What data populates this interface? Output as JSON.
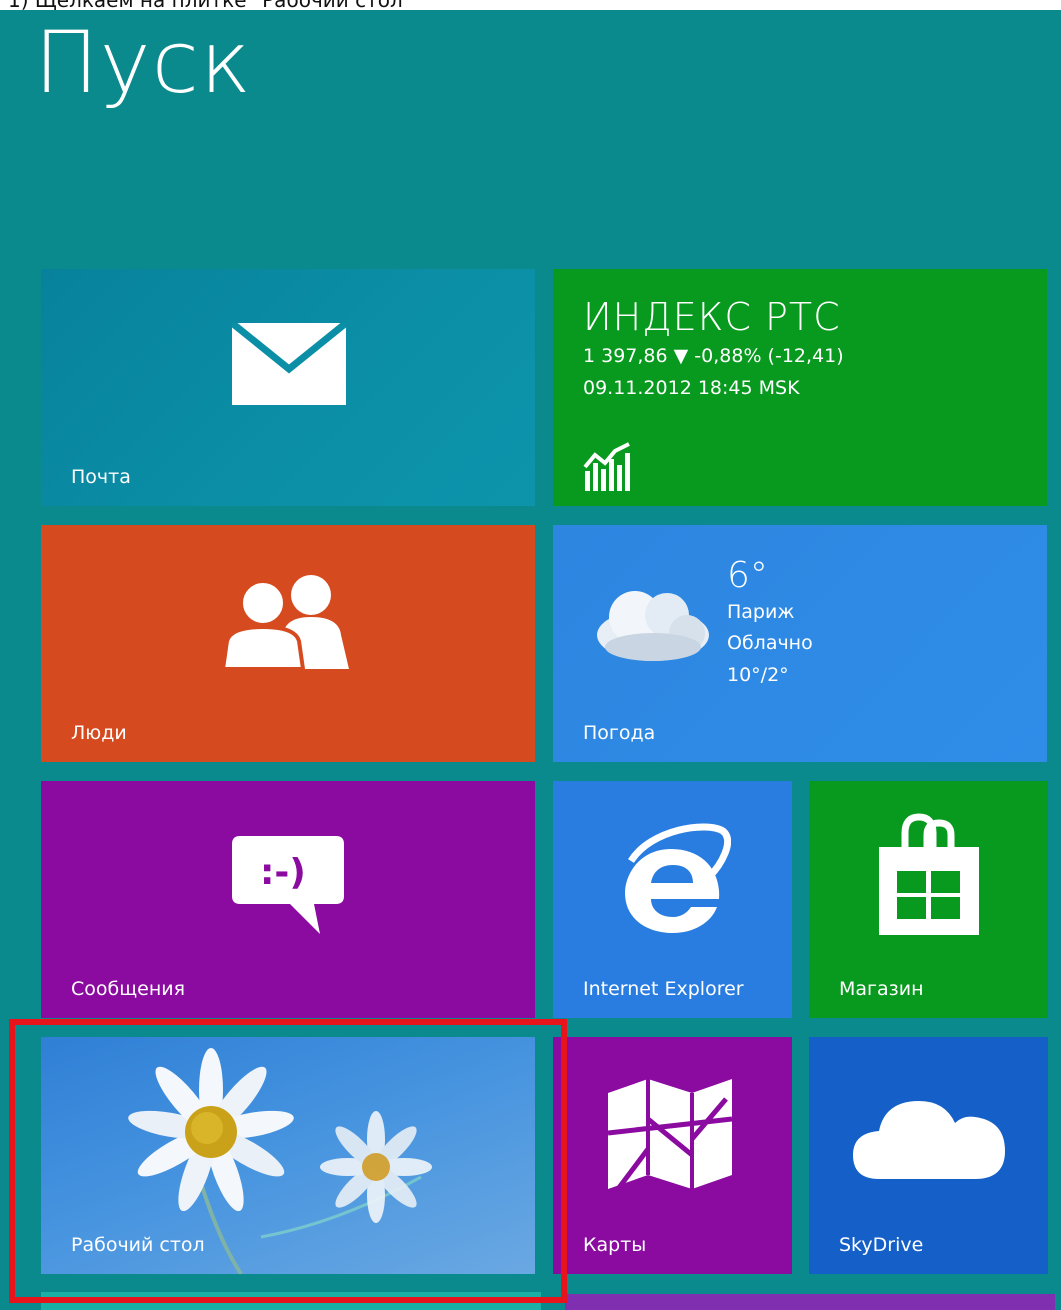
{
  "caption": "1) Щелкаем на плитке \"Рабочий стол\"",
  "start_title": "Пуск",
  "tiles": {
    "mail": {
      "label": "Почта",
      "icon": "mail-envelope-icon"
    },
    "stock": {
      "title": "ИНДЕКС РТС",
      "line1": "1 397,86 ▼ -0,88% (-12,41)",
      "line2": "09.11.2012 18:45 MSK",
      "icon": "finance-chart-icon"
    },
    "people": {
      "label": "Люди",
      "icon": "people-icon"
    },
    "weather": {
      "label": "Погода",
      "temp": "6°",
      "city": "Париж",
      "condition": "Облачно",
      "range": "10°/2°",
      "icon": "cloud-icon"
    },
    "messaging": {
      "label": "Сообщения",
      "icon": "chat-bubble-icon"
    },
    "ie": {
      "label": "Internet Explorer",
      "icon": "internet-explorer-icon"
    },
    "store": {
      "label": "Магазин",
      "icon": "store-bag-icon"
    },
    "desktop": {
      "label": "Рабочий стол",
      "icon": "daisy-wallpaper"
    },
    "maps": {
      "label": "Карты",
      "icon": "map-icon"
    },
    "skydrive": {
      "label": "SkyDrive",
      "icon": "skydrive-cloud-icon"
    }
  },
  "colors": {
    "background": "#0a8a8c",
    "highlight": "#e8141b",
    "mail": "#0b8fa7",
    "finance": "#079a1e",
    "people": "#d64a1f",
    "weather": "#2f8de8",
    "messaging": "#8b0aa0",
    "ie": "#2a7de0",
    "store": "#079a1e",
    "maps": "#8b0aa0",
    "skydrive": "#1460c8"
  }
}
